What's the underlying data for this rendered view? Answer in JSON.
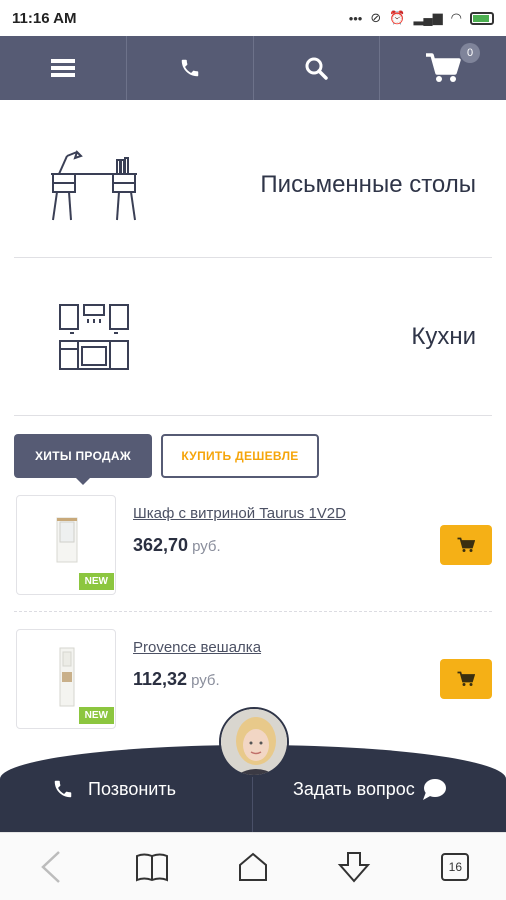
{
  "status": {
    "time": "11:16 AM"
  },
  "topnav": {
    "cart_count": "0"
  },
  "categories": [
    {
      "label": "Письменные столы"
    },
    {
      "label": "Кухни"
    }
  ],
  "tabs": {
    "active": "ХИТЫ ПРОДАЖ",
    "inactive": "КУПИТЬ ДЕШЕВЛЕ"
  },
  "products": [
    {
      "name": "Шкаф с витриной Taurus 1V2D",
      "price": "362,70",
      "currency": "руб.",
      "badge": "NEW"
    },
    {
      "name": "Provence вешалка",
      "price": "112,32",
      "currency": "руб.",
      "badge": "NEW"
    }
  ],
  "callbar": {
    "call_label": "Позвонить",
    "ask_label": "Задать вопрос"
  },
  "browser": {
    "tabs_count": "16"
  },
  "colors": {
    "nav": "#565b74",
    "accent": "#f5b016",
    "dark": "#2f3548",
    "new_badge": "#8cc63f"
  }
}
